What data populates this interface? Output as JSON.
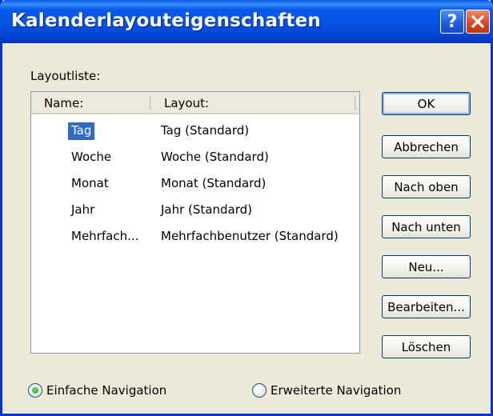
{
  "window": {
    "title": "Kalenderlayouteigenschaften",
    "help_glyph": "?",
    "close_icon": "close-x-icon",
    "accent": "#0a5ae8",
    "selection_color": "#316ac5"
  },
  "layout_list": {
    "label": "Layoutliste:",
    "columns": [
      "Name:",
      "Layout:"
    ],
    "rows": [
      {
        "name": "Tag",
        "layout": "Tag (Standard)",
        "selected": true
      },
      {
        "name": "Woche",
        "layout": "Woche (Standard)",
        "selected": false
      },
      {
        "name": "Monat",
        "layout": "Monat (Standard)",
        "selected": false
      },
      {
        "name": "Jahr",
        "layout": "Jahr (Standard)",
        "selected": false
      },
      {
        "name": "Mehrfach...",
        "layout": "Mehrfachbenutzer (Standard)",
        "selected": false
      }
    ]
  },
  "buttons": {
    "ok": "OK",
    "cancel": "Abbrechen",
    "up": "Nach oben",
    "down": "Nach unten",
    "new": "Neu...",
    "edit": "Bearbeiten...",
    "delete": "Löschen"
  },
  "navigation": {
    "simple": "Einfache Navigation",
    "extended": "Erweiterte Navigation",
    "selected": "simple"
  }
}
